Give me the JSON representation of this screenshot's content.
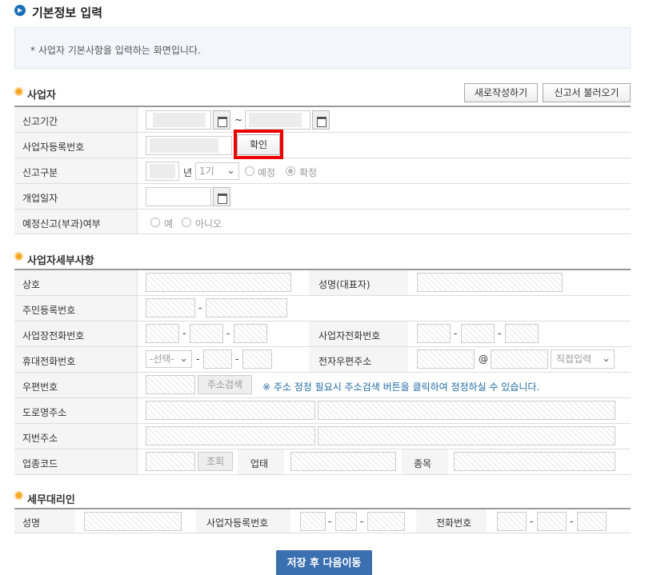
{
  "page": {
    "title": "기본정보 입력",
    "info": "* 사업자 기본사항을 입력하는 화면입니다."
  },
  "sections": {
    "business": "사업자",
    "details": "사업자세부사항",
    "agent": "세무대리인"
  },
  "header_buttons": {
    "new": "새로작성하기",
    "load": "신고서 불러오기"
  },
  "business": {
    "period_label": "신고기간",
    "period_sep": "~",
    "regno_label": "사업자등록번호",
    "confirm_button": "확인",
    "type_label": "신고구분",
    "year_suffix": "년",
    "term_selected": "1기",
    "radio_pre": "예정",
    "radio_final": "확정",
    "open_date_label": "개업일자",
    "pre_report_label": "예정신고(부과)여부",
    "radio_yes": "예",
    "radio_no": "아니오"
  },
  "details": {
    "name_label": "상호",
    "rep_label": "성명(대표자)",
    "ssn_label": "주민등록번호",
    "biz_phone_label": "사업장전화번호",
    "owner_phone_label": "사업자전화번호",
    "mobile_label": "휴대전화번호",
    "mobile_select": "-선택-",
    "email_label": "전자우편주소",
    "email_at": "@",
    "email_select": "직접입력",
    "zip_label": "우편번호",
    "zip_button": "주소검색",
    "zip_note": "※ 주소 정정 필요시 주소검색 버튼을 클릭하여 정정하실 수 있습니다.",
    "road_label": "도로명주소",
    "lot_label": "지번주소",
    "industry_label": "업종코드",
    "industry_button": "조회",
    "biz_type_label": "업태",
    "biz_item_label": "종목",
    "dash": "-"
  },
  "agent": {
    "name_label": "성명",
    "regno_label": "사업자등록번호",
    "phone_label": "전화번호"
  },
  "submit": "저장 후 다음이동"
}
